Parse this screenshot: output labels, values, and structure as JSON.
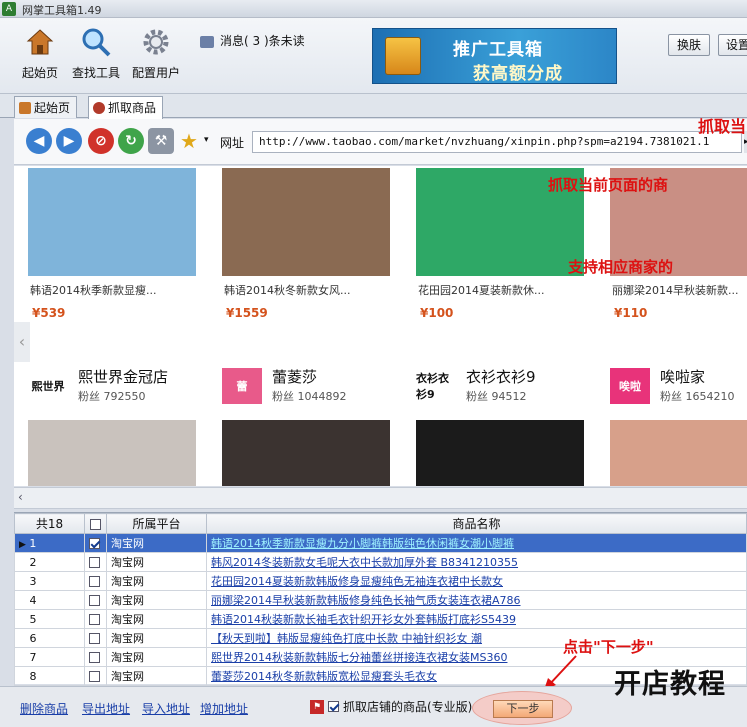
{
  "window": {
    "title": "网掌工具箱1.49",
    "app_icon": "A"
  },
  "toolbar": {
    "buttons": [
      {
        "label": "起始页",
        "icon": "house-icon"
      },
      {
        "label": "查找工具",
        "icon": "magnifier-icon"
      },
      {
        "label": "配置用户",
        "icon": "gear-icon"
      }
    ],
    "message_prefix": "消息(",
    "message_count": "3",
    "message_suffix": ")条未读",
    "banner_line1": "推广工具箱",
    "banner_line2": "获高额分成",
    "switch_label": "换肤",
    "settings_label": "设置"
  },
  "tabs": [
    {
      "label": "起始页",
      "active": false
    },
    {
      "label": "抓取商品",
      "active": true
    }
  ],
  "nav": {
    "address_label": "网址",
    "url": "http://www.taobao.com/market/nvzhuang/xinpin.php?spm=a2194.7381021.1"
  },
  "annotations": {
    "top_right": "抓取当",
    "red1": "抓取当前页面的商",
    "red2": "支持相应商家的",
    "click_next": "点击\"下一步\"",
    "watermark": "开店教程"
  },
  "products_row1": [
    {
      "name": "韩语2014秋季新款显瘦...",
      "price": "¥539",
      "color": "#7fb4da"
    },
    {
      "name": "韩语2014秋冬新款女风...",
      "price": "¥1559",
      "color": "#8a6a52"
    },
    {
      "name": "花田园2014夏装新款休...",
      "price": "¥100",
      "color": "#2ea866"
    },
    {
      "name": "丽娜梁2014早秋装新款...",
      "price": "¥110",
      "color": "#c98f84"
    }
  ],
  "shops": [
    {
      "logo": "熙世界",
      "name": "熙世界金冠店",
      "sub": "粉丝 792550",
      "logo_bg": "#ffffff",
      "logo_color": "#111111"
    },
    {
      "logo": "蕾",
      "name": "蕾菱莎",
      "sub": "粉丝 1044892",
      "logo_bg": "#e85a8a",
      "logo_color": "#ffffff"
    },
    {
      "logo": "衣衫衣衫9",
      "name": "衣衫衣衫9",
      "sub": "粉丝 94512",
      "logo_bg": "#ffffff",
      "logo_color": "#111111"
    },
    {
      "logo": "唉啦",
      "name": "唉啦家",
      "sub": "粉丝 1654210",
      "logo_bg": "#e8337a",
      "logo_color": "#ffffff"
    }
  ],
  "products_row2": [
    {
      "color": "#c9c2bd"
    },
    {
      "color": "#3b3330"
    },
    {
      "color": "#1b1b1b"
    },
    {
      "color": "#d7a08a"
    }
  ],
  "grid": {
    "count_label": "共18",
    "col_platform": "所属平台",
    "col_name": "商品名称",
    "rows": [
      {
        "num": "1",
        "checked": true,
        "platform": "淘宝网",
        "name": "韩语2014秋季新款显瘦九分小脚裤韩版纯色休闲裤女潮小脚裤",
        "selected": true
      },
      {
        "num": "2",
        "checked": false,
        "platform": "淘宝网",
        "name": "韩风2014冬装新款女毛呢大衣中长款加厚外套 B8341210355"
      },
      {
        "num": "3",
        "checked": false,
        "platform": "淘宝网",
        "name": "花田园2014夏装新款韩版修身显瘦纯色无袖连衣裙中长款女"
      },
      {
        "num": "4",
        "checked": false,
        "platform": "淘宝网",
        "name": "丽娜梁2014早秋装新款韩版修身纯色长袖气质女装连衣裙A786"
      },
      {
        "num": "5",
        "checked": false,
        "platform": "淘宝网",
        "name": "韩语2014秋装新款长袖毛衣针织开衫女外套韩版打底衫S5439"
      },
      {
        "num": "6",
        "checked": false,
        "platform": "淘宝网",
        "name": "【秋天到啦】韩版显瘦纯色打底中长款 中袖针织衫女 潮"
      },
      {
        "num": "7",
        "checked": false,
        "platform": "淘宝网",
        "name": "熙世界2014秋装新款韩版七分袖蕾丝拼接连衣裙女装MS360"
      },
      {
        "num": "8",
        "checked": false,
        "platform": "淘宝网",
        "name": "蕾菱莎2014秋冬新款韩版宽松显瘦套头毛衣女"
      }
    ]
  },
  "bottom": {
    "links": [
      "删除商品",
      "导出地址",
      "导入地址",
      "增加地址"
    ],
    "checkbox_label": "抓取店铺的商品(专业版)",
    "checkbox_checked": true,
    "next_label": "下一步"
  }
}
